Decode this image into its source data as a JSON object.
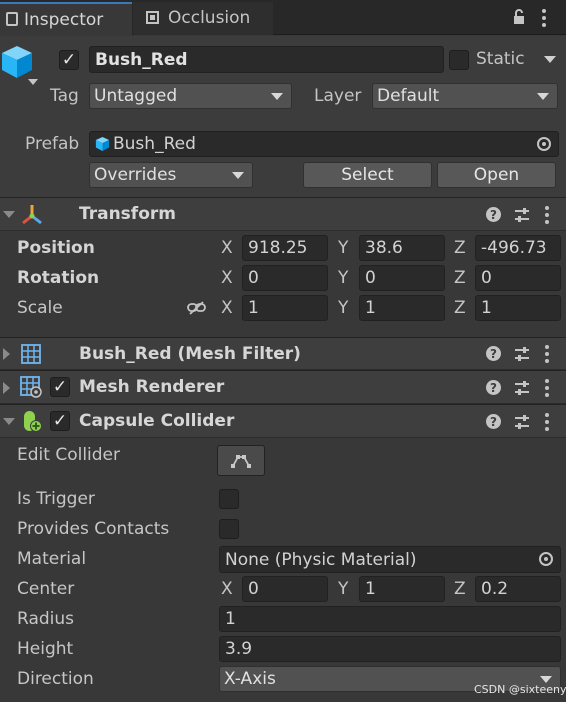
{
  "tabs": [
    {
      "label": "Inspector",
      "active": true
    },
    {
      "label": "Occlusion",
      "active": false
    }
  ],
  "gameobject": {
    "enabled": "✓",
    "name": "Bush_Red",
    "static_label": "Static",
    "tag_label": "Tag",
    "tag_value": "Untagged",
    "layer_label": "Layer",
    "layer_value": "Default"
  },
  "prefab": {
    "label": "Prefab",
    "asset": "Bush_Red",
    "overrides": "Overrides",
    "select": "Select",
    "open": "Open"
  },
  "transform": {
    "title": "Transform",
    "position_label": "Position",
    "rotation_label": "Rotation",
    "scale_label": "Scale",
    "axes": [
      "X",
      "Y",
      "Z"
    ],
    "position": [
      "918.25",
      "38.6",
      "-496.73"
    ],
    "rotation": [
      "0",
      "0",
      "0"
    ],
    "scale": [
      "1",
      "1",
      "1"
    ]
  },
  "mesh_filter": {
    "title": "Bush_Red (Mesh Filter)"
  },
  "mesh_renderer": {
    "title": "Mesh Renderer",
    "enabled": "✓"
  },
  "collider": {
    "title": "Capsule Collider",
    "enabled": "✓",
    "edit_label": "Edit Collider",
    "is_trigger_label": "Is Trigger",
    "provides_contacts_label": "Provides Contacts",
    "material_label": "Material",
    "material_value": "None (Physic Material)",
    "center_label": "Center",
    "center": [
      "0",
      "1",
      "0.2"
    ],
    "radius_label": "Radius",
    "radius": "1",
    "height_label": "Height",
    "height": "3.9",
    "direction_label": "Direction",
    "direction": "X-Axis"
  },
  "watermark": "CSDN @sixteenyy",
  "colors": {
    "panel": "#383838",
    "header": "#3e3e3e",
    "field": "#2a2a2a",
    "button": "#585858",
    "cube_icon": "#4fc3f7"
  }
}
